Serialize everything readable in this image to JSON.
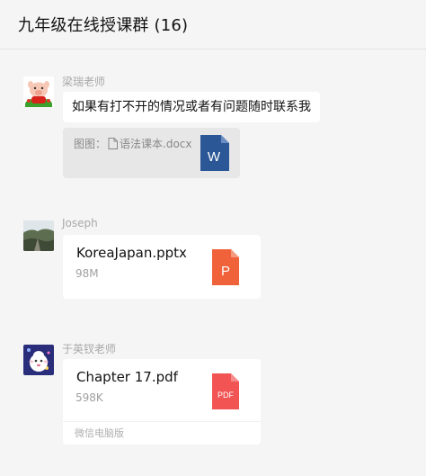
{
  "header": {
    "title": "九年级在线授课群 (16)"
  },
  "messages": [
    {
      "sender": "梁瑞老师",
      "avatar_icon": "cartoon-pig-avatar",
      "text": "如果有打不开的情况或者有问题随时联系我",
      "quote": {
        "prefix": "图图：",
        "file_icon": "document-outline-icon",
        "filename": "语法课本.docx",
        "type_icon": "word-icon",
        "type_letter": "W"
      }
    },
    {
      "sender": "Joseph",
      "avatar_icon": "landscape-photo-avatar",
      "file": {
        "name": "KoreaJapan.pptx",
        "size": "98M",
        "type_icon": "powerpoint-icon",
        "type_letter": "P"
      }
    },
    {
      "sender": "于英钗老师",
      "avatar_icon": "cartoon-sheep-avatar",
      "file": {
        "name": "Chapter 17.pdf",
        "size": "598K",
        "type_icon": "pdf-icon",
        "type_letter": "PDF",
        "source": "微信电脑版"
      }
    }
  ],
  "colors": {
    "word": "#2b5797",
    "ppt": "#f0623a",
    "pdf": "#f25353"
  }
}
